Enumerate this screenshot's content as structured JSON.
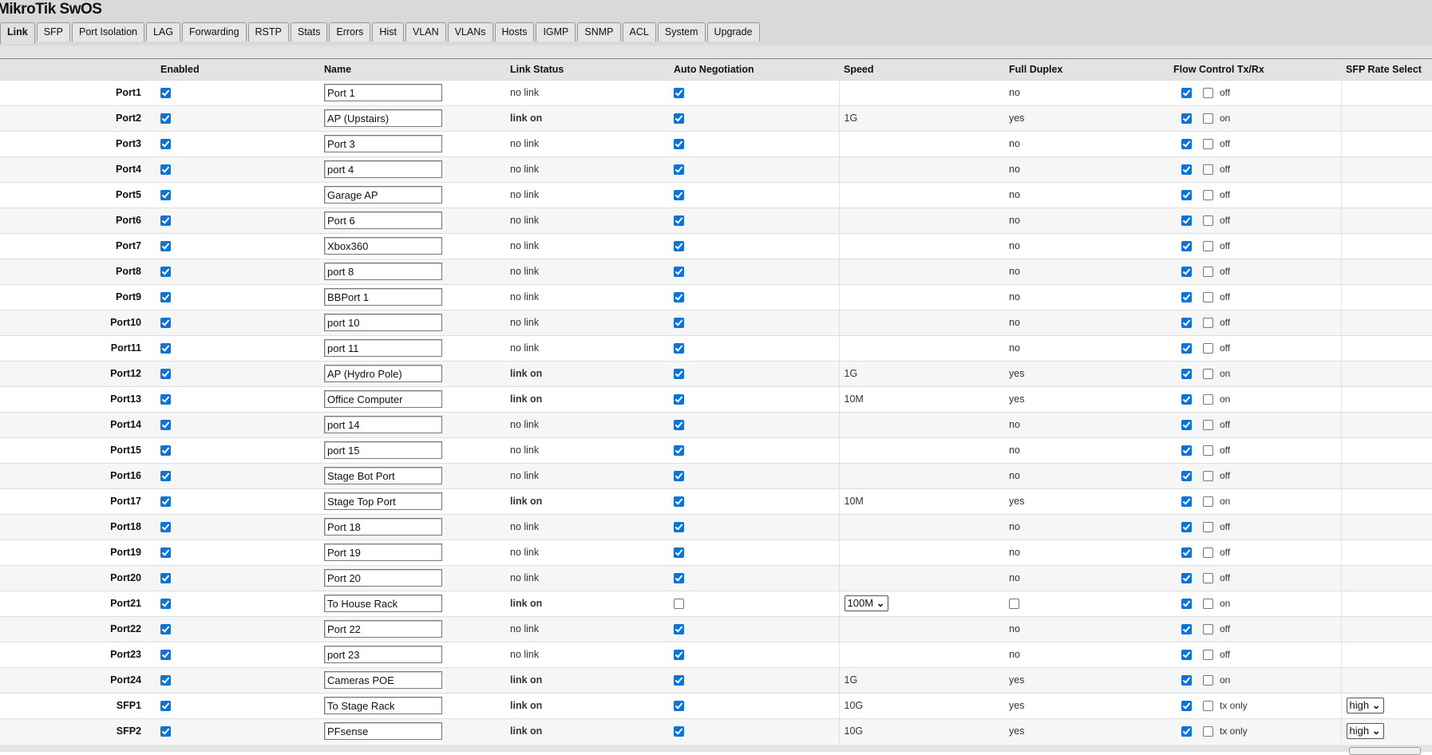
{
  "title": "MikroTik SwOS",
  "tabs": [
    "Link",
    "SFP",
    "Port Isolation",
    "LAG",
    "Forwarding",
    "RSTP",
    "Stats",
    "Errors",
    "Hist",
    "VLAN",
    "VLANs",
    "Hosts",
    "IGMP",
    "SNMP",
    "ACL",
    "System",
    "Upgrade"
  ],
  "active_tab": "Link",
  "columns": [
    "",
    "Enabled",
    "Name",
    "Link Status",
    "Auto Negotiation",
    "Speed",
    "Full Duplex",
    "Flow Control Tx/Rx",
    "SFP Rate Select"
  ],
  "rows": [
    {
      "port": "Port1",
      "enabled": true,
      "name": "Port 1",
      "status": "no link",
      "autoneg": true,
      "speed": "",
      "duplex": "no",
      "fc_tx": true,
      "fc_rx": false,
      "fc": "off"
    },
    {
      "port": "Port2",
      "enabled": true,
      "name": "AP (Upstairs)",
      "status": "link on",
      "autoneg": true,
      "speed": "1G",
      "duplex": "yes",
      "fc_tx": true,
      "fc_rx": false,
      "fc": "on"
    },
    {
      "port": "Port3",
      "enabled": true,
      "name": "Port 3",
      "status": "no link",
      "autoneg": true,
      "speed": "",
      "duplex": "no",
      "fc_tx": true,
      "fc_rx": false,
      "fc": "off"
    },
    {
      "port": "Port4",
      "enabled": true,
      "name": "port 4",
      "status": "no link",
      "autoneg": true,
      "speed": "",
      "duplex": "no",
      "fc_tx": true,
      "fc_rx": false,
      "fc": "off"
    },
    {
      "port": "Port5",
      "enabled": true,
      "name": "Garage AP",
      "status": "no link",
      "autoneg": true,
      "speed": "",
      "duplex": "no",
      "fc_tx": true,
      "fc_rx": false,
      "fc": "off"
    },
    {
      "port": "Port6",
      "enabled": true,
      "name": "Port 6",
      "status": "no link",
      "autoneg": true,
      "speed": "",
      "duplex": "no",
      "fc_tx": true,
      "fc_rx": false,
      "fc": "off"
    },
    {
      "port": "Port7",
      "enabled": true,
      "name": "Xbox360",
      "status": "no link",
      "autoneg": true,
      "speed": "",
      "duplex": "no",
      "fc_tx": true,
      "fc_rx": false,
      "fc": "off"
    },
    {
      "port": "Port8",
      "enabled": true,
      "name": "port 8",
      "status": "no link",
      "autoneg": true,
      "speed": "",
      "duplex": "no",
      "fc_tx": true,
      "fc_rx": false,
      "fc": "off"
    },
    {
      "port": "Port9",
      "enabled": true,
      "name": "BBPort 1",
      "status": "no link",
      "autoneg": true,
      "speed": "",
      "duplex": "no",
      "fc_tx": true,
      "fc_rx": false,
      "fc": "off"
    },
    {
      "port": "Port10",
      "enabled": true,
      "name": "port 10",
      "status": "no link",
      "autoneg": true,
      "speed": "",
      "duplex": "no",
      "fc_tx": true,
      "fc_rx": false,
      "fc": "off"
    },
    {
      "port": "Port11",
      "enabled": true,
      "name": "port 11",
      "status": "no link",
      "autoneg": true,
      "speed": "",
      "duplex": "no",
      "fc_tx": true,
      "fc_rx": false,
      "fc": "off"
    },
    {
      "port": "Port12",
      "enabled": true,
      "name": "AP (Hydro Pole)",
      "status": "link on",
      "autoneg": true,
      "speed": "1G",
      "duplex": "yes",
      "fc_tx": true,
      "fc_rx": false,
      "fc": "on"
    },
    {
      "port": "Port13",
      "enabled": true,
      "name": "Office Computer",
      "status": "link on",
      "autoneg": true,
      "speed": "10M",
      "duplex": "yes",
      "fc_tx": true,
      "fc_rx": false,
      "fc": "on"
    },
    {
      "port": "Port14",
      "enabled": true,
      "name": "port 14",
      "status": "no link",
      "autoneg": true,
      "speed": "",
      "duplex": "no",
      "fc_tx": true,
      "fc_rx": false,
      "fc": "off"
    },
    {
      "port": "Port15",
      "enabled": true,
      "name": "port 15",
      "status": "no link",
      "autoneg": true,
      "speed": "",
      "duplex": "no",
      "fc_tx": true,
      "fc_rx": false,
      "fc": "off"
    },
    {
      "port": "Port16",
      "enabled": true,
      "name": "Stage Bot Port",
      "status": "no link",
      "autoneg": true,
      "speed": "",
      "duplex": "no",
      "fc_tx": true,
      "fc_rx": false,
      "fc": "off"
    },
    {
      "port": "Port17",
      "enabled": true,
      "name": "Stage Top Port",
      "status": "link on",
      "autoneg": true,
      "speed": "10M",
      "duplex": "yes",
      "fc_tx": true,
      "fc_rx": false,
      "fc": "on"
    },
    {
      "port": "Port18",
      "enabled": true,
      "name": "Port 18",
      "status": "no link",
      "autoneg": true,
      "speed": "",
      "duplex": "no",
      "fc_tx": true,
      "fc_rx": false,
      "fc": "off"
    },
    {
      "port": "Port19",
      "enabled": true,
      "name": "Port 19",
      "status": "no link",
      "autoneg": true,
      "speed": "",
      "duplex": "no",
      "fc_tx": true,
      "fc_rx": false,
      "fc": "off"
    },
    {
      "port": "Port20",
      "enabled": true,
      "name": "Port 20",
      "status": "no link",
      "autoneg": true,
      "speed": "",
      "duplex": "no",
      "fc_tx": true,
      "fc_rx": false,
      "fc": "off"
    },
    {
      "port": "Port21",
      "enabled": true,
      "name": "To House Rack",
      "status": "link on",
      "autoneg": false,
      "speed_select": "100M",
      "duplex_checkbox": false,
      "fc_tx": true,
      "fc_rx": false,
      "fc": "on"
    },
    {
      "port": "Port22",
      "enabled": true,
      "name": "Port 22",
      "status": "no link",
      "autoneg": true,
      "speed": "",
      "duplex": "no",
      "fc_tx": true,
      "fc_rx": false,
      "fc": "off"
    },
    {
      "port": "Port23",
      "enabled": true,
      "name": "port 23",
      "status": "no link",
      "autoneg": true,
      "speed": "",
      "duplex": "no",
      "fc_tx": true,
      "fc_rx": false,
      "fc": "off"
    },
    {
      "port": "Port24",
      "enabled": true,
      "name": "Cameras POE",
      "status": "link on",
      "autoneg": true,
      "speed": "1G",
      "duplex": "yes",
      "fc_tx": true,
      "fc_rx": false,
      "fc": "on"
    },
    {
      "port": "SFP1",
      "enabled": true,
      "name": "To Stage Rack",
      "status": "link on",
      "autoneg": true,
      "speed": "10G",
      "duplex": "yes",
      "fc_tx": true,
      "fc_rx": false,
      "fc": "tx only",
      "sfp_rate": "high"
    },
    {
      "port": "SFP2",
      "enabled": true,
      "name": "PFsense",
      "status": "link on",
      "autoneg": true,
      "speed": "10G",
      "duplex": "yes",
      "fc_tx": true,
      "fc_rx": false,
      "fc": "tx only",
      "sfp_rate": "high"
    }
  ]
}
